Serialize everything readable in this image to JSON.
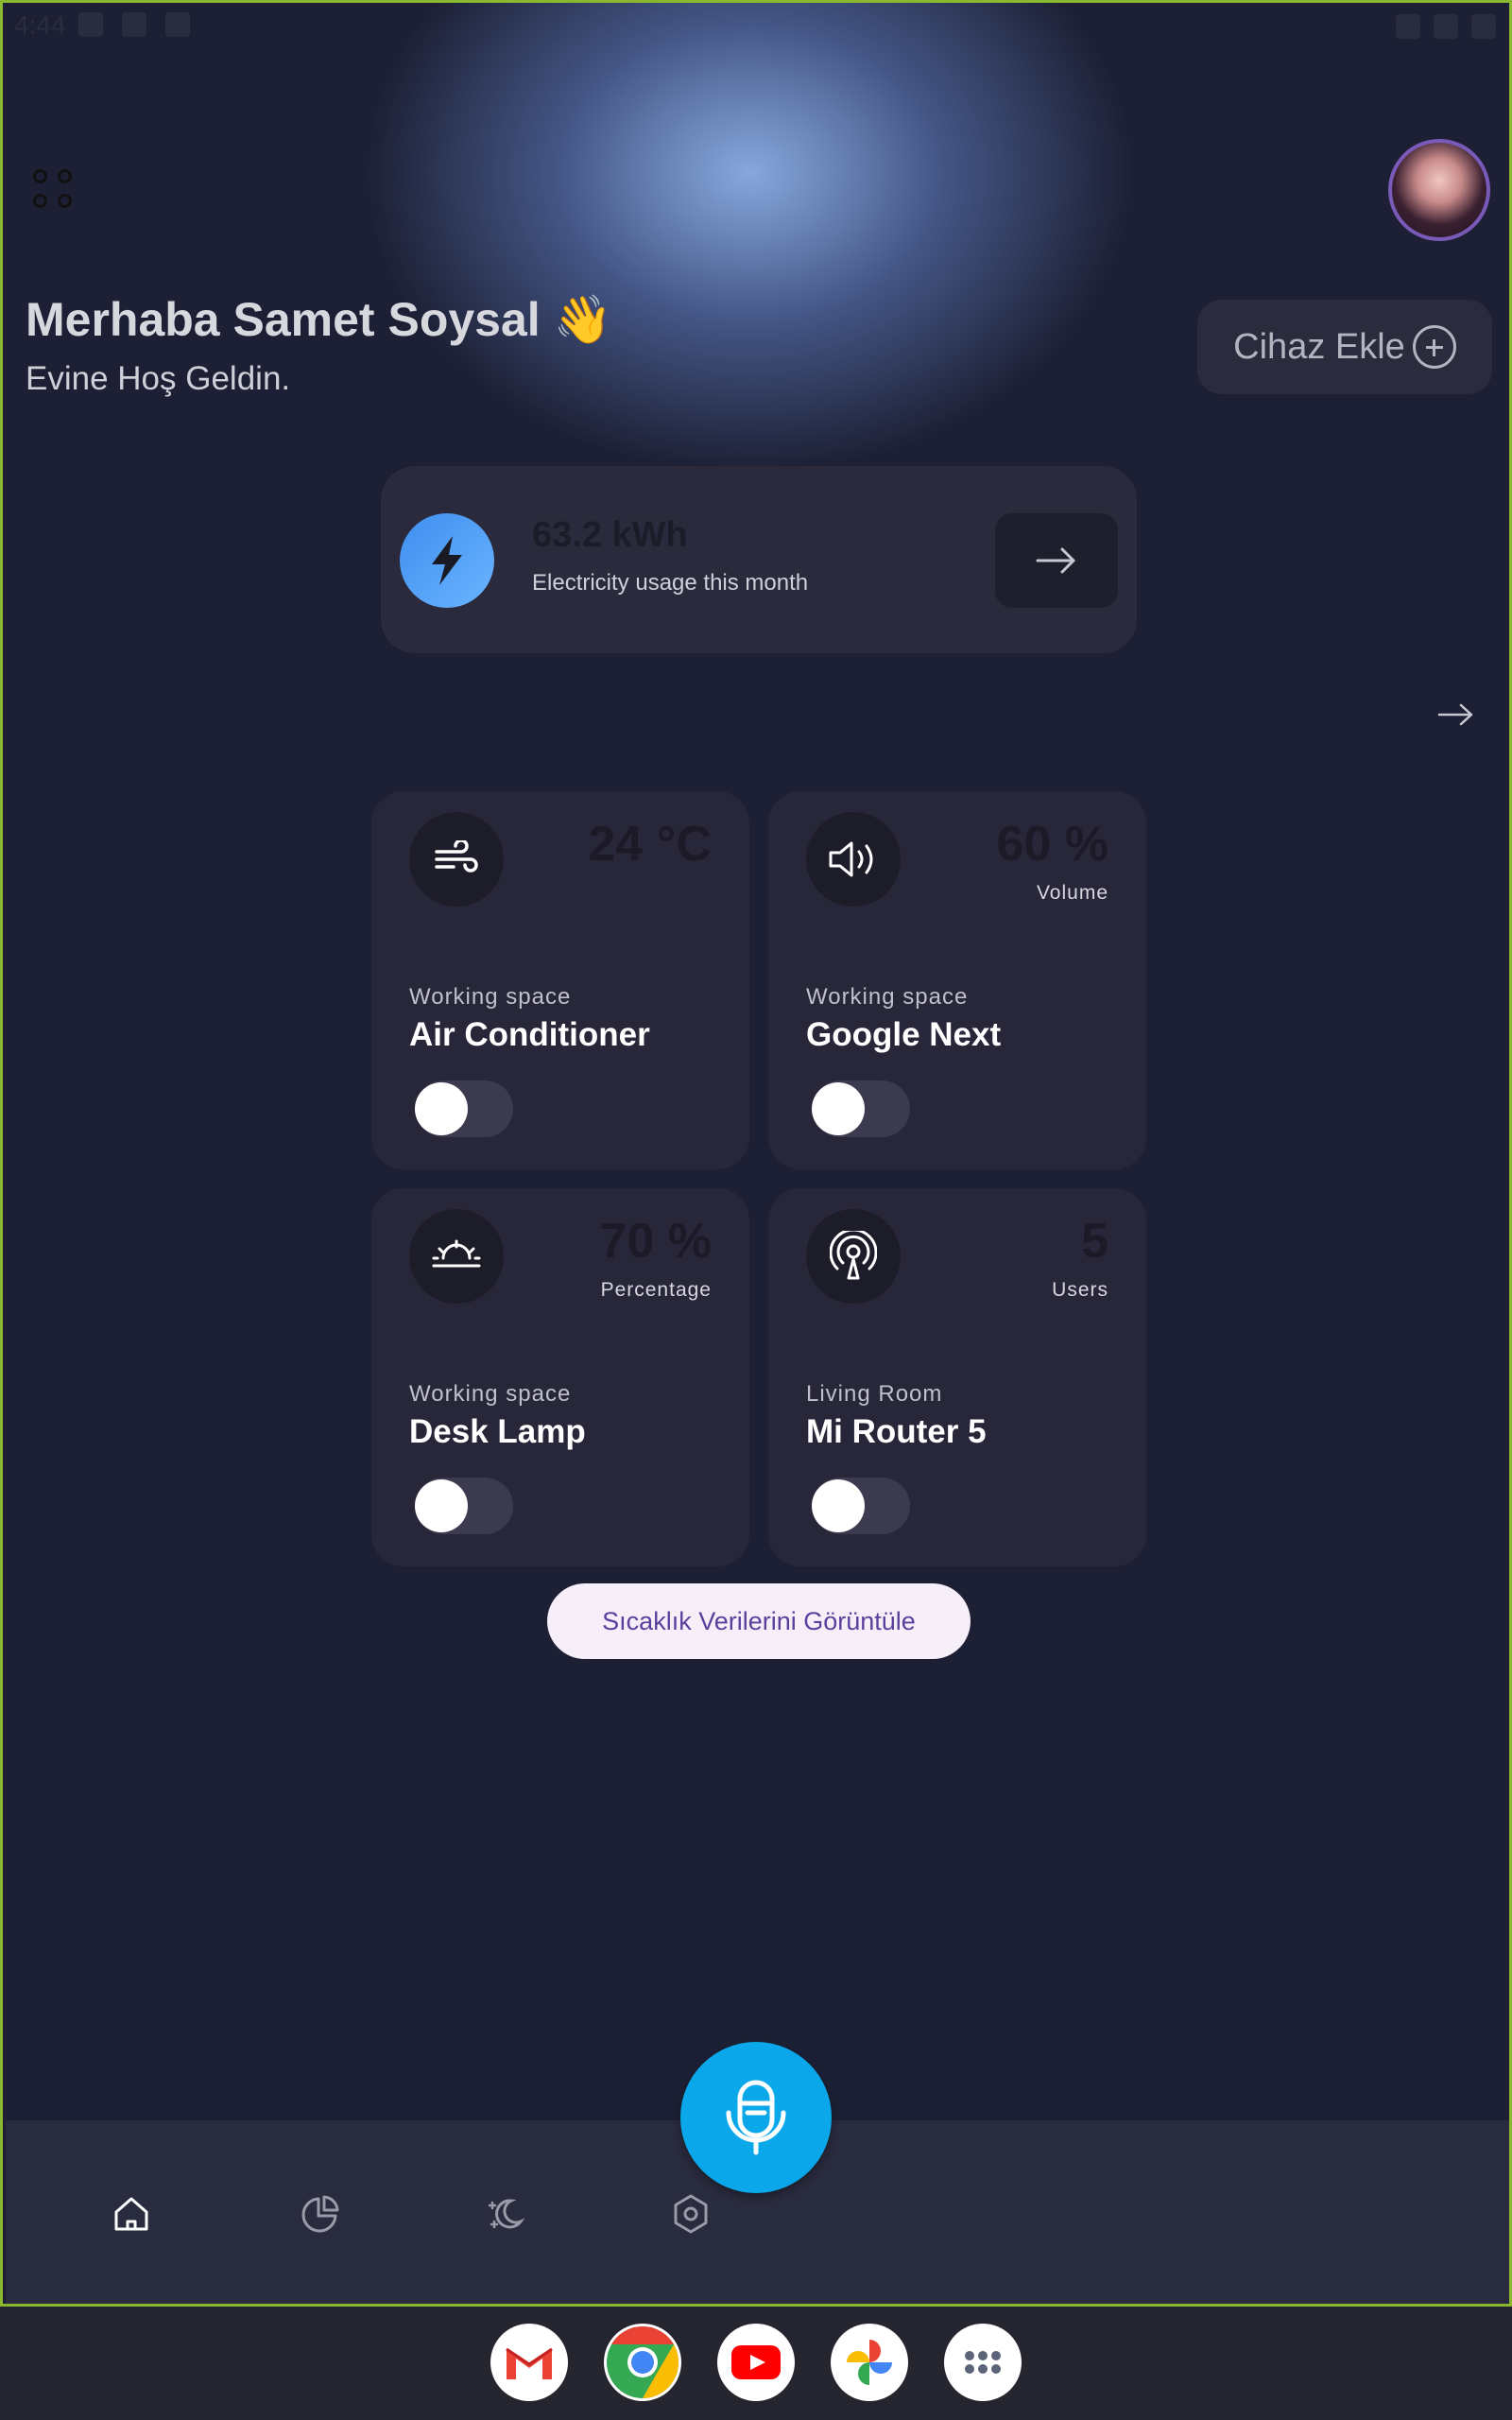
{
  "status_bar": {
    "time": "4:44"
  },
  "header": {
    "greeting": "Merhaba Samet Soysal 👋",
    "subtitle": "Evine Hoş Geldin.",
    "add_device_label": "Cihaz Ekle"
  },
  "energy": {
    "value": "63.2 kWh",
    "label": "Electricity usage this month"
  },
  "devices": [
    {
      "value": "24 °C",
      "unit": "",
      "room": "Working space",
      "name": "Air Conditioner",
      "icon": "wind-icon",
      "on": false
    },
    {
      "value": "60 %",
      "unit": "Volume",
      "room": "Working space",
      "name": "Google Next",
      "icon": "speaker-icon",
      "on": false
    },
    {
      "value": "70 %",
      "unit": "Percentage",
      "room": "Working space",
      "name": "Desk Lamp",
      "icon": "lamp-icon",
      "on": false
    },
    {
      "value": "5",
      "unit": "Users",
      "room": "Living Room",
      "name": "Mi Router 5",
      "icon": "router-icon",
      "on": false
    }
  ],
  "temperature_button_label": "Sıcaklık Verilerini Görüntüle",
  "bottom_nav": [
    "home-icon",
    "stats-icon",
    "scenes-icon",
    "settings-icon"
  ],
  "dock_apps": [
    "Gmail",
    "Chrome",
    "YouTube",
    "Photos",
    "Apps"
  ],
  "colors": {
    "accent": "#0aa8ea",
    "background": "#1d2035",
    "card": "#28273a"
  }
}
